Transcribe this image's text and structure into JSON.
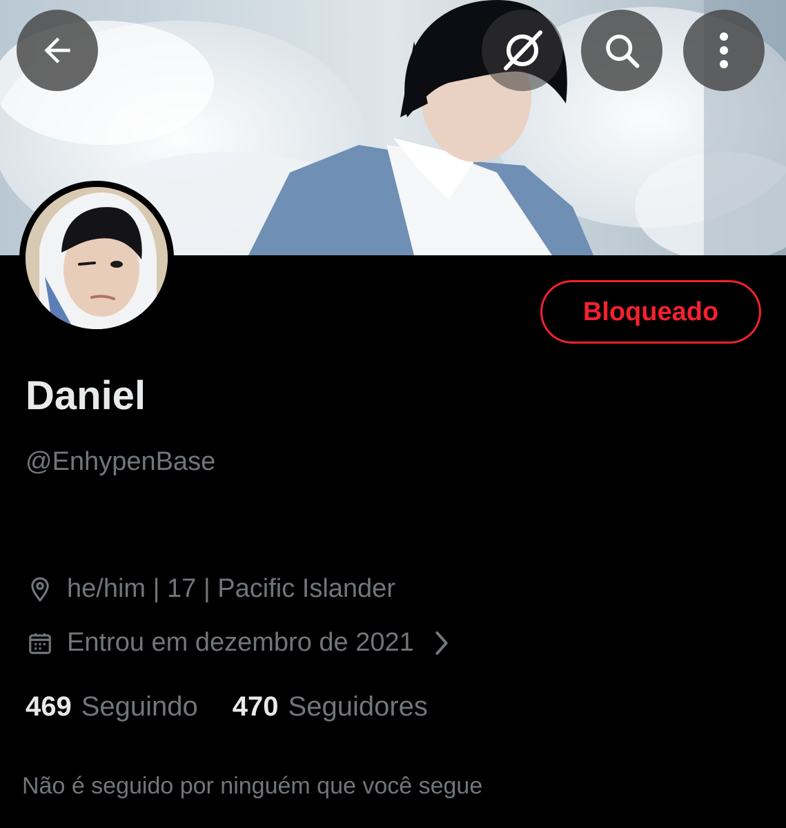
{
  "profile": {
    "display_name": "Daniel",
    "handle": "@EnhypenBase",
    "location": "he/him | 17 | Pacific Islander",
    "joined": "Entrou em dezembro de 2021",
    "following_count": "469",
    "following_label": "Seguindo",
    "followers_count": "470",
    "followers_label": "Seguidores",
    "followed_by_note": "Não é seguido por ninguém que você segue"
  },
  "actions": {
    "blocked_label": "Bloqueado"
  },
  "icons": {
    "back": "arrow-left-icon",
    "grok": "grok-icon",
    "search": "search-icon",
    "more": "more-vertical-icon",
    "location": "location-pin-icon",
    "calendar": "calendar-icon",
    "chevron": "chevron-right-icon"
  },
  "colors": {
    "background": "#000000",
    "text_primary": "#e7e9ea",
    "text_secondary": "#71767b",
    "blocked_red": "#f4212e"
  }
}
